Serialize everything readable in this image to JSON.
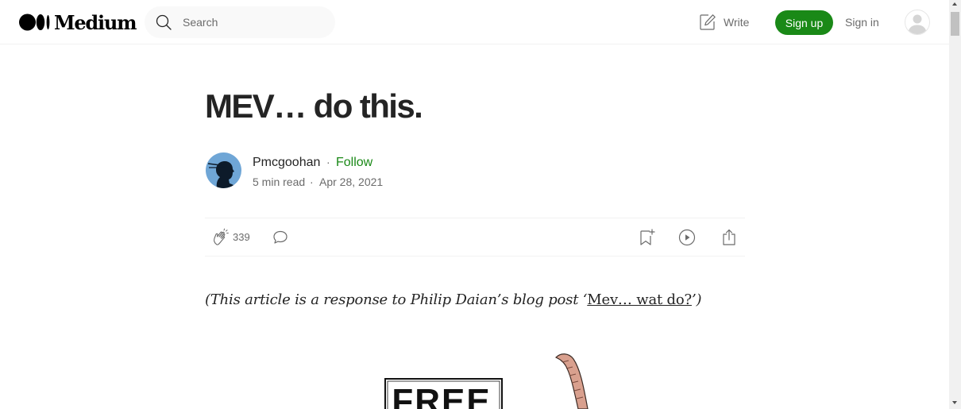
{
  "header": {
    "logo_text": "Medium",
    "search_placeholder": "Search",
    "write_label": "Write",
    "signup_label": "Sign up",
    "signin_label": "Sign in"
  },
  "article": {
    "title": "MEV… do this.",
    "author": "Pmcgoohan",
    "separator": "·",
    "follow_label": "Follow",
    "read_time": "5 min read",
    "date": "Apr 28, 2021",
    "claps": "339",
    "intro_prefix": "(This article is a response to Philip Daian’s blog post ‘",
    "intro_link": "Mev… wat do?",
    "intro_suffix": "’)",
    "figure_sign_text": "FREE"
  },
  "colors": {
    "brand_green": "#1a8917",
    "text_primary": "#242424",
    "text_secondary": "#6b6b6b"
  },
  "icons": [
    "medium-logo-icon",
    "search-icon",
    "write-icon",
    "user-avatar-icon",
    "clap-icon",
    "comment-icon",
    "bookmark-add-icon",
    "play-circle-icon",
    "share-icon"
  ]
}
